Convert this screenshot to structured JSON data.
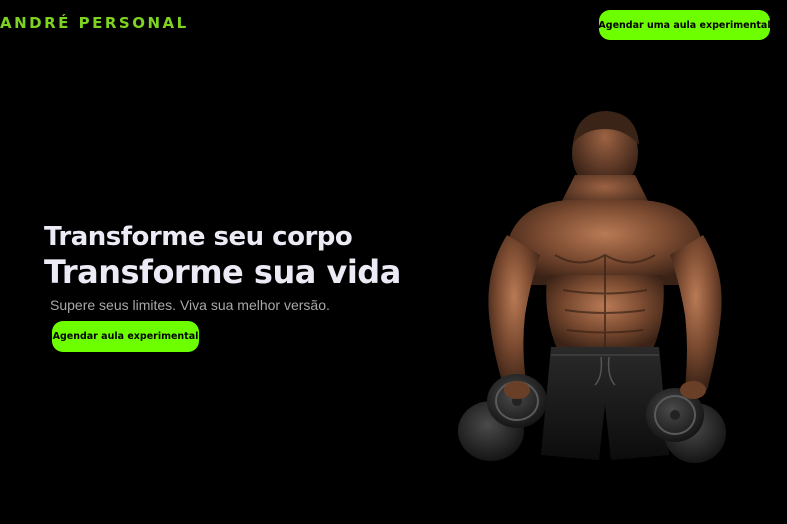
{
  "header": {
    "brand": "ANDRÉ PERSONAL",
    "cta_label": "Agendar uma aula experimental"
  },
  "hero": {
    "headline_line1": "Transforme seu corpo",
    "headline_line2": "Transforme sua vida",
    "subtitle": "Supere seus limites. Viva sua melhor versão.",
    "cta_label": "Agendar aula experimental",
    "image": "muscular-man-holding-dumbbells-photo"
  },
  "colors": {
    "background": "#000000",
    "accent": "#6dff00",
    "brand_text": "#7ed321",
    "headline_text": "#eceaf4",
    "subtitle_text": "#a8a8a8"
  }
}
